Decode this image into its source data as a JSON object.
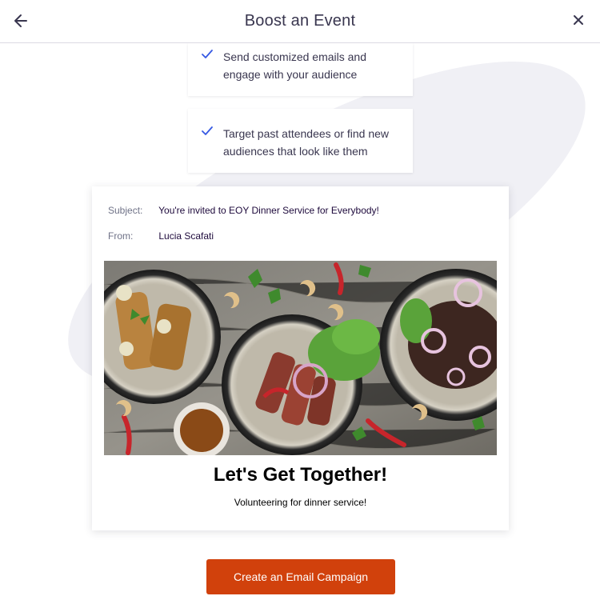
{
  "header": {
    "title": "Boost an Event",
    "back_icon": "arrow-left-icon",
    "close_icon": "close-icon"
  },
  "features": [
    {
      "icon": "check-icon",
      "text": "Send customized emails and engage with your audience"
    },
    {
      "icon": "check-icon",
      "text": "Target past attendees or find new audiences that look like them"
    }
  ],
  "email_preview": {
    "subject_label": "Subject:",
    "subject_value": "You're invited to EOY Dinner Service for Everybody!",
    "from_label": "From:",
    "from_value": "Lucia Scafati",
    "image": "food-photo",
    "headline": "Let's Get Together!",
    "subheadline": "Volunteering for dinner service!"
  },
  "cta": {
    "label": "Create an Email Campaign"
  },
  "colors": {
    "accent": "#d1410c",
    "check": "#3659e3",
    "text": "#39364f",
    "blob": "#f0f0f5"
  }
}
